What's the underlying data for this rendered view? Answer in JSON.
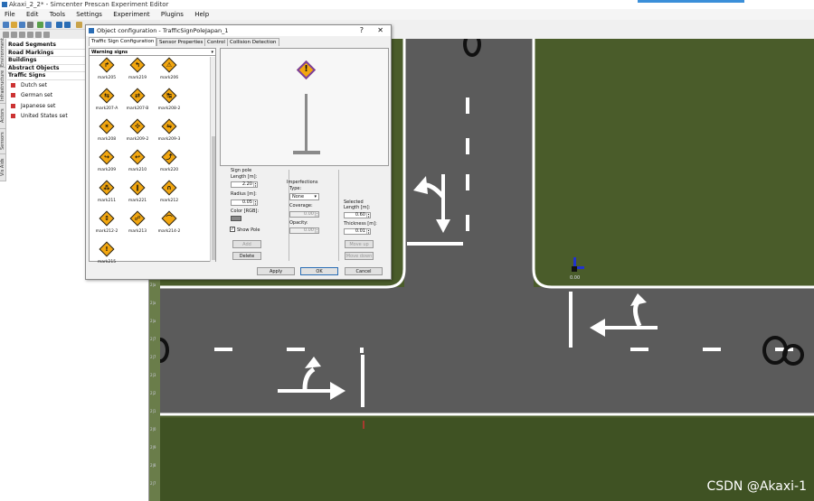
{
  "window": {
    "title": "Akaxi_2_2* - Simcenter Prescan Experiment Editor"
  },
  "menu": [
    "File",
    "Edit",
    "Tools",
    "Settings",
    "Experiment",
    "Plugins",
    "Help"
  ],
  "left_panel": {
    "vertical_tabs": [
      "Environment",
      "Infrastructure",
      "Actors",
      "Sensors",
      "Vis Aids"
    ],
    "categories": [
      "Road Segments",
      "Road Markings",
      "Buildings",
      "Abstract Objects",
      "Traffic Signs"
    ],
    "sign_sets": [
      "Dutch set",
      "German set",
      "Japanese set",
      "United States set"
    ]
  },
  "ruler_labels": [
    "2|a",
    "2|a",
    "2|a",
    "2|7",
    "2|7",
    "2|3",
    "2|2",
    "2|1",
    "2|0",
    "2|9",
    "2|8",
    "2|7"
  ],
  "dialog": {
    "title": "Object configuration - TrafficSignPoleJapan_1",
    "help": "?",
    "close": "✕",
    "tabs": [
      "Traffic Sign Configuration",
      "Sensor Properties",
      "Control",
      "Collision Detection"
    ],
    "sign_category": "Warning signs",
    "signs": [
      {
        "name": "mark205",
        "glyph": "↱"
      },
      {
        "name": "mark219",
        "glyph": "↰"
      },
      {
        "name": "mark206",
        "glyph": "⚠"
      },
      {
        "name": "mark207-A",
        "glyph": "⇆"
      },
      {
        "name": "mark207-B",
        "glyph": "⇄"
      },
      {
        "name": "mark208-2",
        "glyph": "↹"
      },
      {
        "name": "mark208",
        "glyph": "✶"
      },
      {
        "name": "mark209-2",
        "glyph": "✣"
      },
      {
        "name": "mark209-3",
        "glyph": "⇋"
      },
      {
        "name": "mark209",
        "glyph": "↪"
      },
      {
        "name": "mark210",
        "glyph": "↩"
      },
      {
        "name": "mark220",
        "glyph": "⤴"
      },
      {
        "name": "mark211",
        "glyph": "⁂"
      },
      {
        "name": "mark221",
        "glyph": "∥"
      },
      {
        "name": "mark212",
        "glyph": "∩"
      },
      {
        "name": "mark212-2",
        "glyph": "↕"
      },
      {
        "name": "mark213",
        "glyph": "☍"
      },
      {
        "name": "mark214-2",
        "glyph": "⌒"
      },
      {
        "name": "mark215",
        "glyph": "!"
      }
    ],
    "sign_pole": {
      "header": "Sign pole",
      "length_label": "Length [m]:",
      "length_value": "2.20",
      "radius_label": "Radius [m]:",
      "radius_value": "0.05",
      "color_label": "Color [RGB]:",
      "color": "#888888",
      "show_pole_label": "Show Pole",
      "show_pole_checked": "✓",
      "add_label": "Add",
      "delete_label": "Delete"
    },
    "imperfections": {
      "header": "Imperfections",
      "type_label": "Type:",
      "type_value": "None",
      "coverage_label": "Coverage:",
      "coverage_value": "0.00",
      "opacity_label": "Opacity:",
      "opacity_value": "0.00"
    },
    "selected": {
      "header": "Selected",
      "length_label": "Length [m]:",
      "length_value": "0.60",
      "thickness_label": "Thickness [m]:",
      "thickness_value": "0.01",
      "move_up_label": "Move up",
      "move_down_label": "Move down"
    },
    "buttons": {
      "apply": "Apply",
      "ok": "OK",
      "cancel": "Cancel"
    }
  },
  "scene": {
    "axis_label": "0.00"
  },
  "watermark": "CSDN @Akaxi-1",
  "colors": {
    "grass": "#4a5c2a",
    "road": "#5b5b5b",
    "sign_fill": "#f2a60f",
    "accent": "#2a6db5"
  }
}
